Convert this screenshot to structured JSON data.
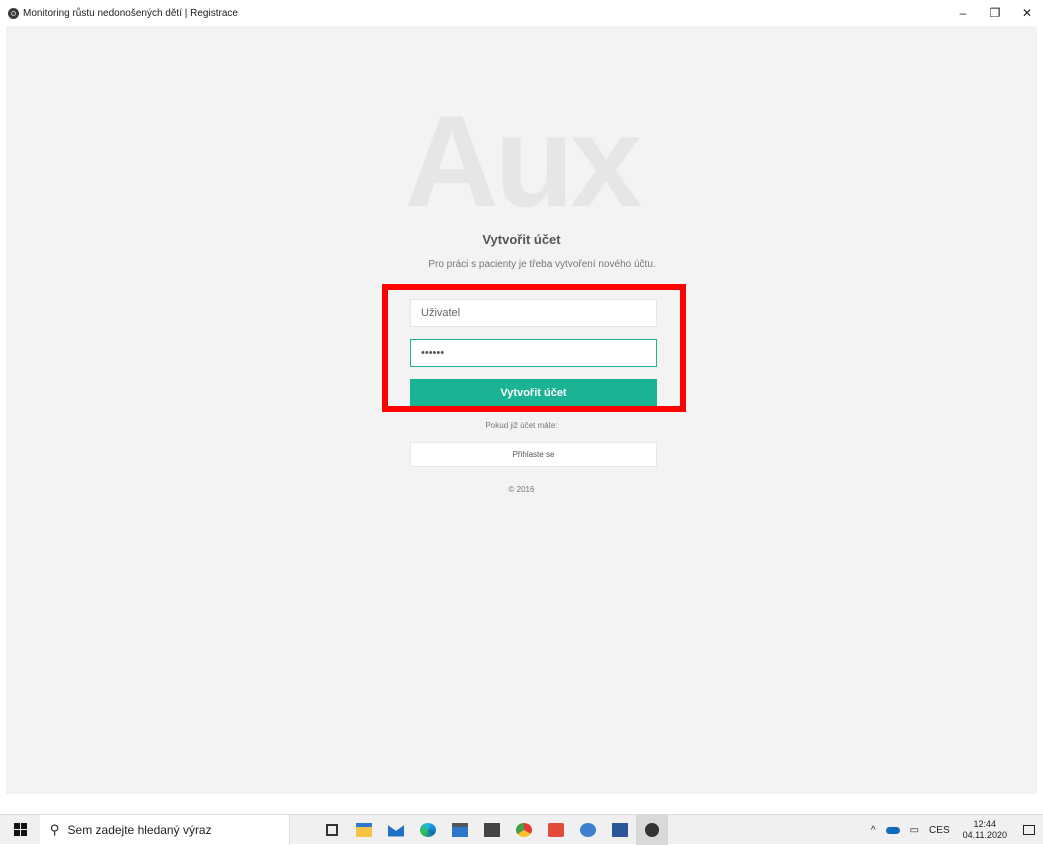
{
  "window": {
    "title": "Monitoring růstu nedonošených dětí | Registrace",
    "minimize": "–",
    "restore": "❐",
    "close": "✕"
  },
  "page": {
    "logo": "Aux",
    "heading": "Vytvořit účet",
    "subtitle": "Pro práci s pacienty je třeba vytvoření nového účtu.",
    "username_placeholder": "Uživatel",
    "password_value": "••••••",
    "create_button": "Vytvořit účet",
    "have_account_text": "Pokud již účet máte:",
    "login_button": "Přihlaste se",
    "copyright": "© 2016",
    "highlight_color": "#ff0000",
    "accent_color": "#1ab394"
  },
  "taskbar": {
    "search_placeholder": "Sem zadejte hledaný výraz",
    "icons": [
      "task-view-icon",
      "file-explorer-icon",
      "mail-icon",
      "edge-icon",
      "store-icon",
      "calculator-icon",
      "chrome-icon",
      "snipping-icon",
      "paint-icon",
      "word-icon",
      "electron-app-icon"
    ],
    "tray": {
      "chevron": "^",
      "language": "CES",
      "time": "12:44",
      "date": "04.11.2020"
    }
  }
}
